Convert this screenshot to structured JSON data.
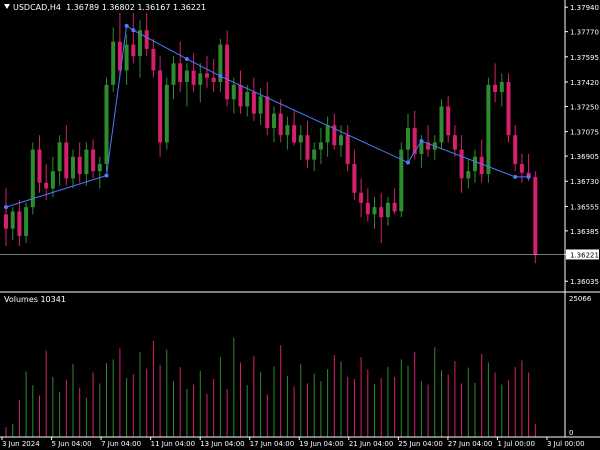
{
  "header": {
    "symbol": "USDCAD,H4",
    "open": "1.36789",
    "high": "1.36802",
    "low": "1.36167",
    "close": "1.36221"
  },
  "volumes_panel": {
    "label": "Volumes 10341",
    "max_label": "25066",
    "min_label": "0"
  },
  "colors": {
    "bull": "#2e8b2e",
    "bear": "#d6206b",
    "doji": "#cfcfcf",
    "trendline": "#4b7bff",
    "axis": "#ffffff",
    "background": "#000000"
  },
  "chart_data": {
    "type": "candlestick",
    "instrument": "USDCAD",
    "timeframe": "H4",
    "ylim": [
      1.3596,
      1.3799
    ],
    "price_ticks": [
      "1.37940",
      "1.37770",
      "1.37595",
      "1.37420",
      "1.37250",
      "1.37075",
      "1.36905",
      "1.36730",
      "1.36555",
      "1.36385",
      "1.36221",
      "1.36035"
    ],
    "current_price": "1.36221",
    "x_labels": [
      "3 Jun 2024",
      "5 Jun 04:00",
      "7 Jun 04:00",
      "11 Jun 04:00",
      "13 Jun 04:00",
      "17 Jun 04:00",
      "19 Jun 04:00",
      "21 Jun 04:00",
      "25 Jun 04:00",
      "27 Jun 04:00",
      "1 Jul 00:00",
      "3 Jul 00:00"
    ],
    "candles": [
      [
        1.365,
        1.3668,
        1.3628,
        1.364
      ],
      [
        1.364,
        1.3655,
        1.3632,
        1.3652
      ],
      [
        1.3652,
        1.366,
        1.3628,
        1.3635
      ],
      [
        1.3635,
        1.3658,
        1.363,
        1.3655
      ],
      [
        1.3655,
        1.37,
        1.365,
        1.3695
      ],
      [
        1.3695,
        1.3705,
        1.3665,
        1.3672
      ],
      [
        1.3672,
        1.3685,
        1.366,
        1.3668
      ],
      [
        1.3668,
        1.369,
        1.3662,
        1.368
      ],
      [
        1.368,
        1.3705,
        1.367,
        1.37
      ],
      [
        1.37,
        1.3712,
        1.367,
        1.3675
      ],
      [
        1.3675,
        1.3695,
        1.3668,
        1.369
      ],
      [
        1.369,
        1.37,
        1.3672,
        1.3678
      ],
      [
        1.3678,
        1.37,
        1.367,
        1.3695
      ],
      [
        1.3695,
        1.3702,
        1.3675,
        1.368
      ],
      [
        1.368,
        1.369,
        1.3668,
        1.3685
      ],
      [
        1.3685,
        1.3745,
        1.368,
        1.374
      ],
      [
        1.374,
        1.378,
        1.3735,
        1.377
      ],
      [
        1.377,
        1.379,
        1.3745,
        1.375
      ],
      [
        1.375,
        1.3775,
        1.374,
        1.3768
      ],
      [
        1.3768,
        1.379,
        1.3755,
        1.376
      ],
      [
        1.376,
        1.3785,
        1.3745,
        1.3778
      ],
      [
        1.3778,
        1.379,
        1.376,
        1.3765
      ],
      [
        1.3765,
        1.3772,
        1.3745,
        1.375
      ],
      [
        1.375,
        1.376,
        1.369,
        1.37
      ],
      [
        1.37,
        1.3745,
        1.3695,
        1.374
      ],
      [
        1.374,
        1.376,
        1.373,
        1.3755
      ],
      [
        1.3755,
        1.377,
        1.3735,
        1.3742
      ],
      [
        1.3742,
        1.3755,
        1.3725,
        1.375
      ],
      [
        1.375,
        1.3762,
        1.3735,
        1.374
      ],
      [
        1.374,
        1.3755,
        1.3728,
        1.3748
      ],
      [
        1.3748,
        1.376,
        1.3738,
        1.3745
      ],
      [
        1.3745,
        1.3758,
        1.3735,
        1.3742
      ],
      [
        1.3742,
        1.3772,
        1.3735,
        1.3768
      ],
      [
        1.3768,
        1.3778,
        1.3725,
        1.373
      ],
      [
        1.373,
        1.3745,
        1.372,
        1.374
      ],
      [
        1.374,
        1.375,
        1.372,
        1.3725
      ],
      [
        1.3725,
        1.374,
        1.3718,
        1.3735
      ],
      [
        1.3735,
        1.3745,
        1.3715,
        1.372
      ],
      [
        1.372,
        1.3738,
        1.3712,
        1.3732
      ],
      [
        1.3732,
        1.3742,
        1.3705,
        1.371
      ],
      [
        1.371,
        1.3725,
        1.37,
        1.372
      ],
      [
        1.372,
        1.373,
        1.37,
        1.3705
      ],
      [
        1.3705,
        1.3718,
        1.3695,
        1.3712
      ],
      [
        1.3712,
        1.3722,
        1.3698,
        1.37
      ],
      [
        1.37,
        1.3712,
        1.3688,
        1.3705
      ],
      [
        1.3705,
        1.3715,
        1.3682,
        1.3688
      ],
      [
        1.3688,
        1.37,
        1.368,
        1.3695
      ],
      [
        1.3695,
        1.371,
        1.3685,
        1.37
      ],
      [
        1.37,
        1.3718,
        1.369,
        1.3712
      ],
      [
        1.3712,
        1.372,
        1.3695,
        1.3698
      ],
      [
        1.3698,
        1.3712,
        1.369,
        1.3705
      ],
      [
        1.3705,
        1.3712,
        1.368,
        1.3685
      ],
      [
        1.3685,
        1.3695,
        1.366,
        1.3665
      ],
      [
        1.3665,
        1.3675,
        1.3648,
        1.3658
      ],
      [
        1.3658,
        1.3668,
        1.3645,
        1.365
      ],
      [
        1.365,
        1.3662,
        1.364,
        1.3655
      ],
      [
        1.3655,
        1.3665,
        1.363,
        1.3648
      ],
      [
        1.3648,
        1.3662,
        1.3642,
        1.3658
      ],
      [
        1.3658,
        1.3668,
        1.365,
        1.3652
      ],
      [
        1.3652,
        1.37,
        1.3648,
        1.3695
      ],
      [
        1.3695,
        1.372,
        1.3685,
        1.371
      ],
      [
        1.371,
        1.3722,
        1.3688,
        1.3692
      ],
      [
        1.3692,
        1.3705,
        1.3682,
        1.37
      ],
      [
        1.37,
        1.3712,
        1.369,
        1.3695
      ],
      [
        1.3695,
        1.3705,
        1.3688,
        1.37
      ],
      [
        1.37,
        1.373,
        1.3695,
        1.3725
      ],
      [
        1.3725,
        1.3732,
        1.37,
        1.3705
      ],
      [
        1.3705,
        1.3712,
        1.369,
        1.3695
      ],
      [
        1.3695,
        1.3705,
        1.3665,
        1.3675
      ],
      [
        1.3675,
        1.3688,
        1.3668,
        1.368
      ],
      [
        1.368,
        1.3695,
        1.3672,
        1.369
      ],
      [
        1.369,
        1.3702,
        1.3672,
        1.3678
      ],
      [
        1.3678,
        1.3745,
        1.3672,
        1.374
      ],
      [
        1.374,
        1.3755,
        1.3728,
        1.3735
      ],
      [
        1.3735,
        1.3748,
        1.3725,
        1.3742
      ],
      [
        1.3742,
        1.3748,
        1.37,
        1.3705
      ],
      [
        1.3705,
        1.3712,
        1.368,
        1.3685
      ],
      [
        1.3685,
        1.3692,
        1.3672,
        1.3679
      ],
      [
        1.3679,
        1.3692,
        1.3673,
        1.3676
      ],
      [
        1.3676,
        1.368,
        1.3616,
        1.3622
      ]
    ],
    "volumes": [
      1800,
      2400,
      6800,
      12000,
      9500,
      7600,
      15800,
      11000,
      8200,
      10500,
      13400,
      9000,
      7200,
      11800,
      9800,
      13500,
      14200,
      16200,
      10800,
      11500,
      15500,
      12500,
      17600,
      13200,
      16000,
      10200,
      12800,
      8800,
      9600,
      12100,
      7900,
      10600,
      14600,
      8800,
      18200,
      13600,
      9500,
      14800,
      11900,
      7800,
      12900,
      16800,
      11200,
      9200,
      13400,
      9800,
      11600,
      10200,
      12400,
      15000,
      13800,
      11000,
      10600,
      14600,
      12400,
      9700,
      10800,
      12800,
      11000,
      14200,
      13000,
      15600,
      10200,
      9600,
      16400,
      12200,
      11400,
      13900,
      9800,
      12700,
      9900,
      15200,
      13600,
      11800,
      9600,
      10400,
      12800,
      14000,
      11800,
      2400
    ],
    "trendlines": [
      {
        "points": [
          [
            0,
            1.3655
          ],
          [
            15,
            1.3677
          ],
          [
            18,
            1.3781
          ]
        ]
      },
      {
        "points": [
          [
            18,
            1.3781
          ],
          [
            19,
            1.3778
          ],
          [
            27,
            1.3758
          ],
          [
            32,
            1.3746
          ],
          [
            60,
            1.3686
          ],
          [
            62,
            1.3701
          ],
          [
            76,
            1.3676
          ],
          [
            78,
            1.3676
          ]
        ]
      }
    ]
  }
}
